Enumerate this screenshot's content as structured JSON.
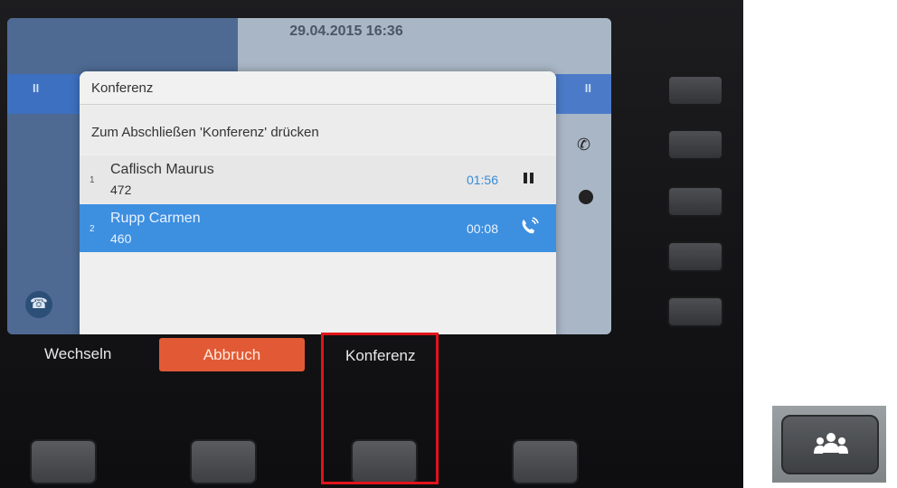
{
  "background_screen": {
    "datetime": "29.04.2015 16:36",
    "pause_glyph": "II"
  },
  "dialog": {
    "title": "Konferenz",
    "instruction": "Zum Abschließen 'Konferenz' drücken",
    "calls": [
      {
        "index": "1",
        "name": "Caflisch Maurus",
        "number": "472",
        "duration": "01:56",
        "status_icon": "pause-icon",
        "selected": false
      },
      {
        "index": "2",
        "name": "Rupp Carmen",
        "number": "460",
        "duration": "00:08",
        "status_icon": "active-call-icon",
        "selected": true
      }
    ]
  },
  "softkeys": {
    "wechseln": "Wechseln",
    "abbruch": "Abbruch",
    "konferenz": "Konferenz"
  },
  "colors": {
    "selected_row": "#3d8fe0",
    "abbruch_button": "#e25a35",
    "highlight_frame": "#e0141a",
    "line_led": "#66e040"
  },
  "inset": {
    "icon": "conference-icon"
  }
}
